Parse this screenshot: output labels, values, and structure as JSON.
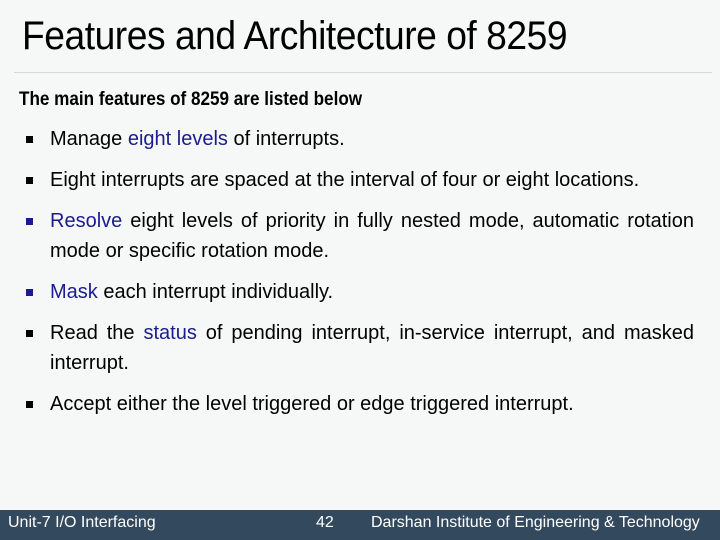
{
  "slide": {
    "title": "Features and Architecture of 8259",
    "intro": "The main features of 8259 are listed below",
    "accent_color": "#1b1b8f",
    "bullets": [
      {
        "bullet_color": "black",
        "parts": [
          {
            "text": "Manage ",
            "hl": false
          },
          {
            "text": "eight levels",
            "hl": true
          },
          {
            "text": " of interrupts.",
            "hl": false
          }
        ]
      },
      {
        "bullet_color": "black",
        "parts": [
          {
            "text": "Eight interrupts are spaced at the interval of four or eight locations.",
            "hl": false
          }
        ]
      },
      {
        "bullet_color": "blue",
        "parts": [
          {
            "text": "Resolve",
            "hl": true
          },
          {
            "text": " eight levels of priority in fully nested mode, automatic rotation mode or specific rotation mode.",
            "hl": false
          }
        ]
      },
      {
        "bullet_color": "blue",
        "parts": [
          {
            "text": "Mask",
            "hl": true
          },
          {
            "text": " each interrupt individually.",
            "hl": false
          }
        ]
      },
      {
        "bullet_color": "black",
        "parts": [
          {
            "text": "Read the ",
            "hl": false
          },
          {
            "text": "status",
            "hl": true
          },
          {
            "text": " of pending interrupt, in-service interrupt, and masked interrupt.",
            "hl": false
          }
        ]
      },
      {
        "bullet_color": "black",
        "parts": [
          {
            "text": "Accept either the level triggered or edge triggered interrupt.",
            "hl": false
          }
        ]
      }
    ]
  },
  "footer": {
    "unit": "Unit-7 I/O Interfacing",
    "page_number": "42",
    "institute": "Darshan Institute of Engineering & Technology",
    "background": "#33495d"
  }
}
